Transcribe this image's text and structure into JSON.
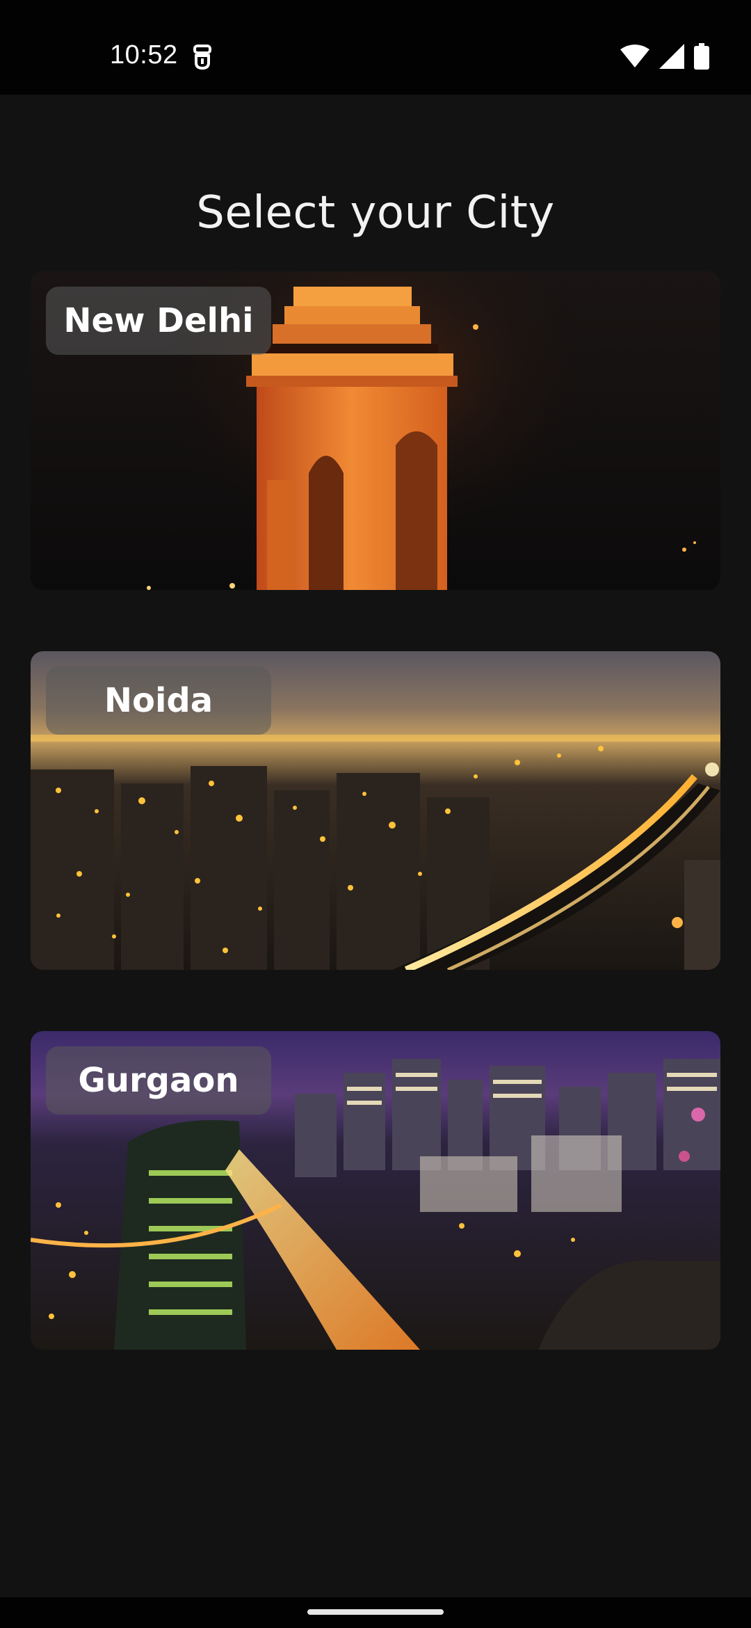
{
  "status_bar": {
    "time": "10:52"
  },
  "page": {
    "title": "Select your City"
  },
  "cities": [
    {
      "name": "New Delhi",
      "image": "india-gate-night"
    },
    {
      "name": "Noida",
      "image": "noida-night-skyline"
    },
    {
      "name": "Gurgaon",
      "image": "gurgaon-night-skyline"
    }
  ],
  "colors": {
    "background": "#121212",
    "status_bar": "#020202",
    "chip": "#5a5a5a",
    "india_gate": "#e8782a",
    "city_lights": "#ffc23a"
  },
  "icons": {
    "notification": "notification-icon",
    "wifi": "wifi-icon",
    "signal": "cellular-signal-icon",
    "battery": "battery-icon"
  }
}
